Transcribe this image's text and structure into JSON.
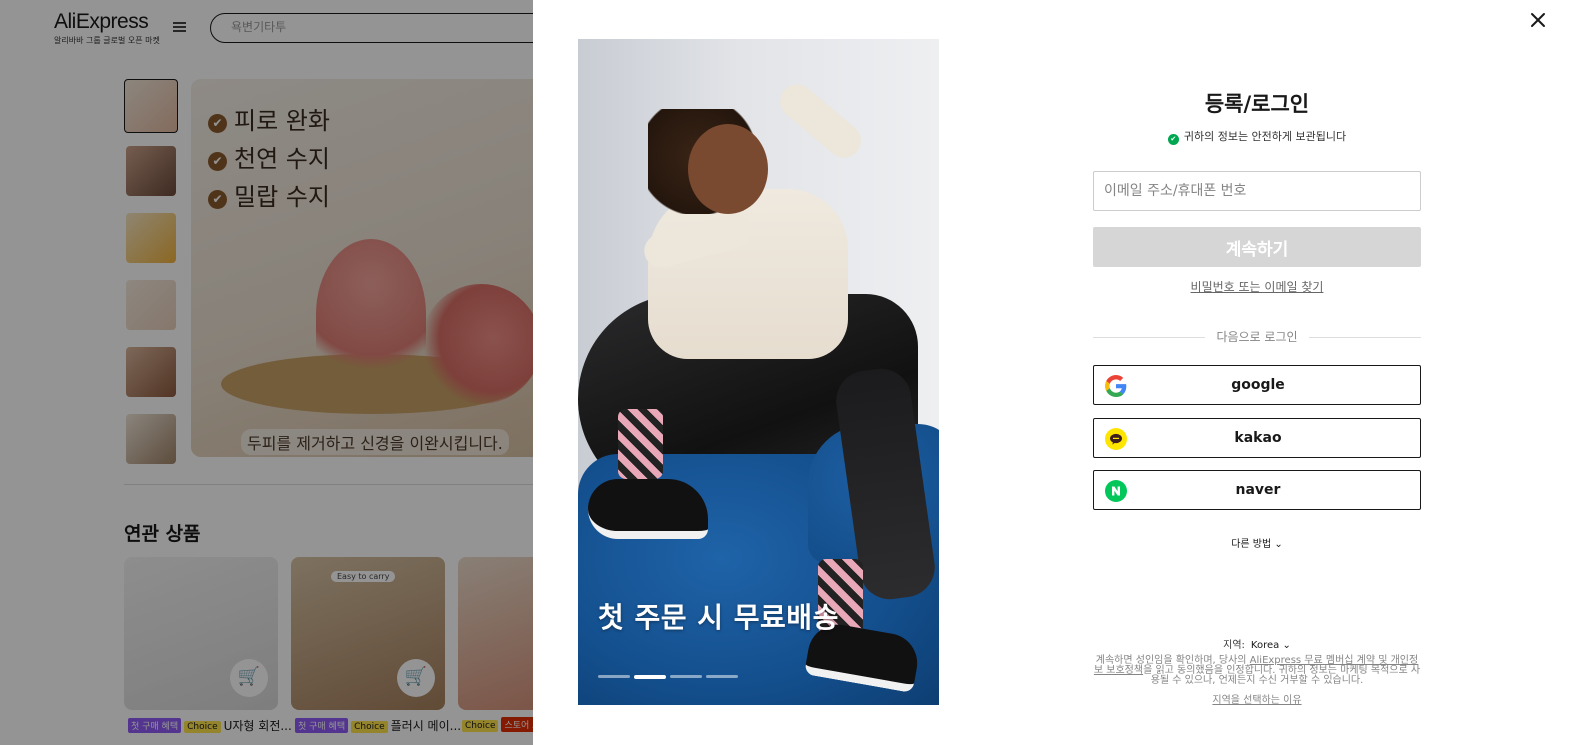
{
  "background": {
    "logo": {
      "brand": "AliExpress",
      "tagline": "알리바바 그룹 글로벌 오픈 마켓"
    },
    "search": {
      "placeholder": "욕변기타투"
    },
    "hero": {
      "lines": [
        "피로 완화",
        "천연 수지",
        "밀랍 수지"
      ],
      "caption": "두피를 제거하고 신경을 이완시킵니다."
    },
    "related": {
      "title": "연관 상품",
      "products": [
        {
          "tags": [
            "첫 구매 혜택",
            "Choice"
          ],
          "name": "U자형 회전..."
        },
        {
          "tags": [
            "첫 구매 혜택",
            "Choice"
          ],
          "name": "플러시 메이...",
          "badge": "Easy to carry"
        },
        {
          "tags": [
            "Choice",
            "스토어 오퍼"
          ],
          "name": ""
        }
      ]
    }
  },
  "modal": {
    "promo": {
      "text": "첫 주문 시 무료배송",
      "slide_count": 4,
      "active_slide": 1
    },
    "title": "등록/로그인",
    "secure_note": "귀하의 정보는 안전하게 보관됩니다",
    "email_placeholder": "이메일 주소/휴대폰 번호",
    "continue_label": "계속하기",
    "forgot_link": "비밀번호 또는 이메일 찾기",
    "or_text": "다음으로 로그인",
    "social": [
      {
        "label": "google",
        "icon": "google-icon"
      },
      {
        "label": "kakao",
        "icon": "kakao-icon"
      },
      {
        "label": "naver",
        "icon": "naver-icon"
      }
    ],
    "more_label": "다른 방법",
    "region_label": "지역:",
    "region_value": "Korea",
    "legal_pre": "계속하면 성인임을 확인하며, 당사의 ",
    "legal_link1": "AliExpress 무료 멤버십 계약 및 개인정보 보호정책",
    "legal_post": "을 읽고 동의했음을 인정합니다. 귀하의 정보는 마케팅 목적으로 사용될 수 있으나, 언제든지 수신 거부할 수 있습니다.",
    "why_region": "지역을 선택하는 이유"
  },
  "colors": {
    "brand_red": "#e62e04",
    "google_blue": "#4285f4",
    "kakao_yellow": "#fee500",
    "naver_green": "#03c75a",
    "secure_green": "#00a650"
  }
}
